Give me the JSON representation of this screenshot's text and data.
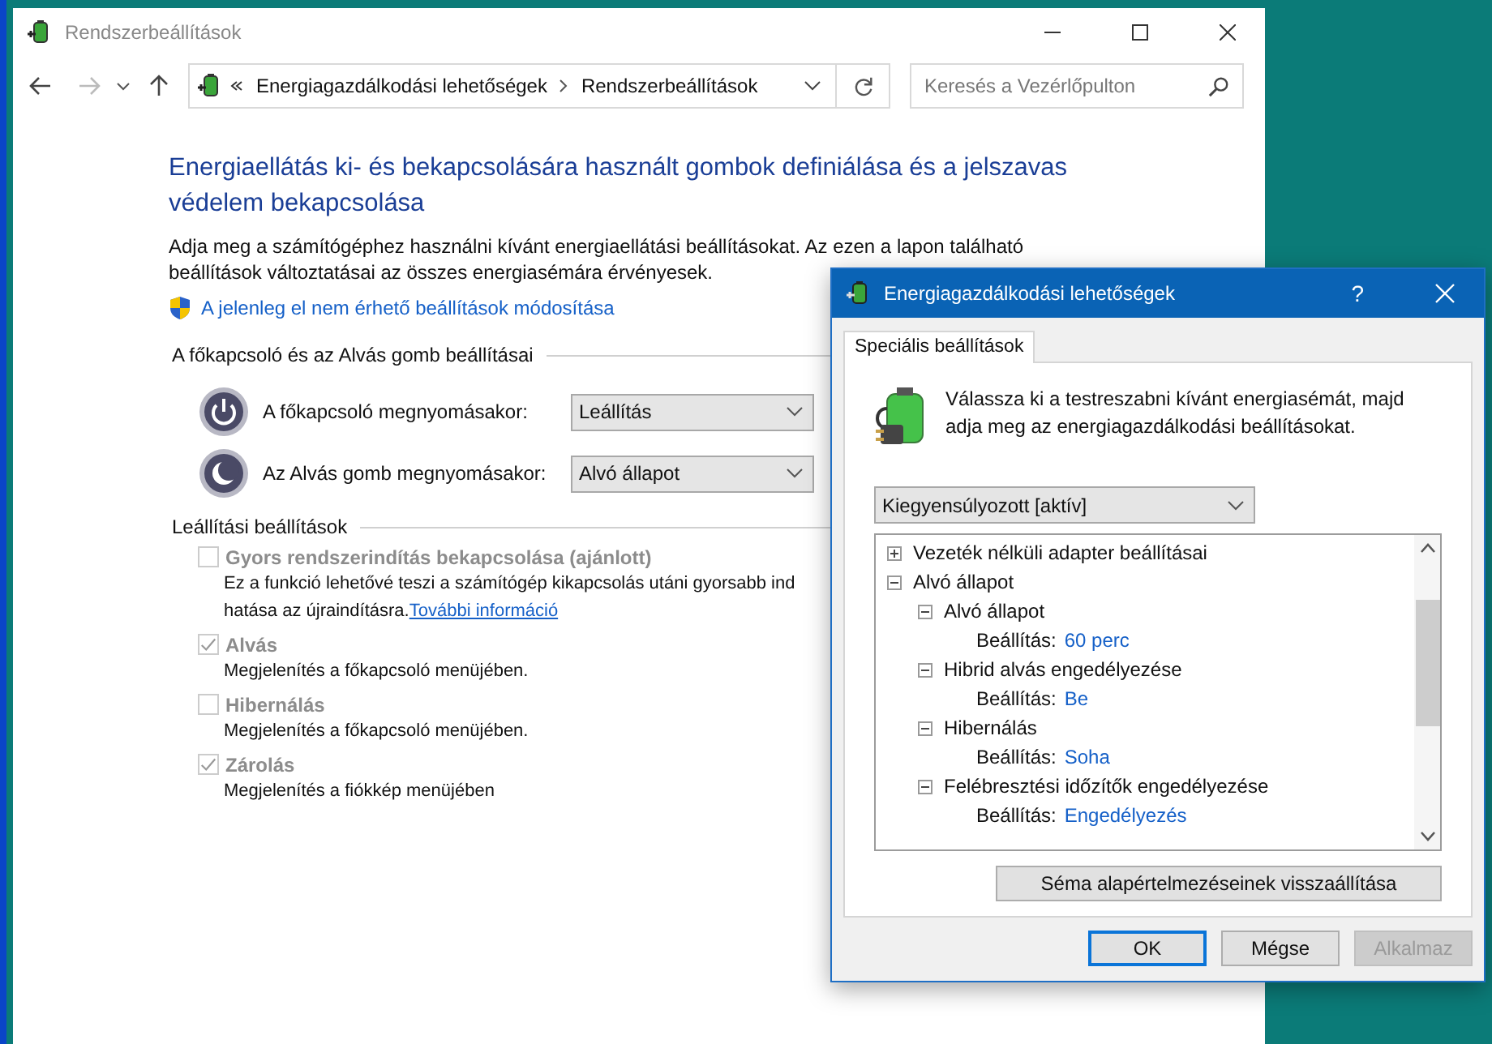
{
  "main_window": {
    "title": "Rendszerbeállítások",
    "breadcrumb": [
      "Energiagazdálkodási lehetőségek",
      "Rendszerbeállítások"
    ],
    "search": {
      "placeholder": "Keresés a Vezérlőpulton"
    },
    "heading": "Energiaellátás ki- és bekapcsolására használt gombok definiálása és a jelszavas védelem bekapcsolása",
    "description": "Adja meg a számítógéphez használni kívánt energiaellátási beállításokat. Az ezen a lapon található beállítások változtatásai az összes energiasémára érvényesek.",
    "admin_link": "A jelenleg el nem érhető beállítások módosítása",
    "button_section": {
      "title": "A főkapcsoló és az Alvás gomb beállításai",
      "rows": [
        {
          "kind": "power",
          "label": "A főkapcsoló megnyomásakor:",
          "value": "Leállítás"
        },
        {
          "kind": "sleep",
          "label": "Az Alvás gomb megnyomásakor:",
          "value": "Alvó állapot"
        }
      ]
    },
    "shutdown_section": {
      "title": "Leállítási beállítások",
      "options": [
        {
          "label": "Gyors rendszerindítás bekapcsolása (ajánlott)",
          "checked": false,
          "disabled": true,
          "description_lines": [
            "Ez a funkció lehetővé teszi a számítógép kikapcsolás utáni gyorsabb ind",
            "hatása az újraindításra."
          ],
          "link": "További információ"
        },
        {
          "label": "Alvás",
          "checked": true,
          "disabled": true,
          "description_lines": [
            "Megjelenítés a főkapcsoló menüjében."
          ]
        },
        {
          "label": "Hibernálás",
          "checked": false,
          "disabled": true,
          "description_lines": [
            "Megjelenítés a főkapcsoló menüjében."
          ]
        },
        {
          "label": "Zárolás",
          "checked": true,
          "disabled": true,
          "description_lines": [
            "Megjelenítés a fiókkép menüjében"
          ]
        }
      ]
    }
  },
  "dialog": {
    "title": "Energiagazdálkodási lehetőségek",
    "help": "?",
    "tabs": [
      {
        "label": "Speciális beállítások",
        "selected": true
      }
    ],
    "intro": "Válassza ki a testreszabni kívánt energiasémát, majd adja meg az energiagazdálkodási beállításokat.",
    "scheme": "Kiegyensúlyozott [aktív]",
    "tree": [
      {
        "label": "Vezeték nélküli adapter beállításai",
        "expanded": false
      },
      {
        "label": "Alvó állapot",
        "expanded": true,
        "children": [
          {
            "label": "Alvó állapot",
            "expanded": true,
            "setting_label": "Beállítás:",
            "setting_value": "60 perc"
          },
          {
            "label": "Hibrid alvás engedélyezése",
            "expanded": true,
            "setting_label": "Beállítás:",
            "setting_value": "Be"
          },
          {
            "label": "Hibernálás",
            "expanded": true,
            "setting_label": "Beállítás:",
            "setting_value": "Soha"
          },
          {
            "label": "Felébresztési időzítők engedélyezése",
            "expanded": true,
            "setting_label": "Beállítás:",
            "setting_value": "Engedélyezés"
          }
        ]
      }
    ],
    "restore_button": "Séma alapértelmezéseinek visszaállítása",
    "buttons": [
      {
        "label": "OK",
        "default": true,
        "disabled": false
      },
      {
        "label": "Mégse",
        "default": false,
        "disabled": false
      },
      {
        "label": "Alkalmaz",
        "default": false,
        "disabled": true
      }
    ]
  }
}
